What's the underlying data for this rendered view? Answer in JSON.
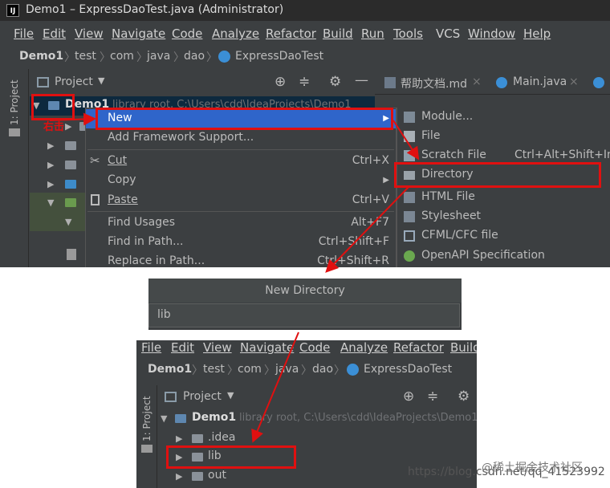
{
  "top": {
    "title": "Demo1 – ExpressDaoTest.java (Administrator)",
    "logo_text": "IJ",
    "menu": [
      "File",
      "Edit",
      "View",
      "Navigate",
      "Code",
      "Analyze",
      "Refactor",
      "Build",
      "Run",
      "Tools",
      "VCS",
      "Window",
      "Help"
    ],
    "breadcrumbs": [
      "Demo1",
      "test",
      "com",
      "java",
      "dao",
      "ExpressDaoTest"
    ],
    "project_label": "Project",
    "side_tab": "1: Project",
    "tree_root": "Demo1",
    "tree_root_hint": "library root, C:\\Users\\cdd\\IdeaProjects\\Demo1",
    "annotation": "右击",
    "tabs": [
      "帮助文档.md",
      "Main.java"
    ],
    "context_menu": [
      {
        "label": "New",
        "shortcut": ""
      },
      {
        "label": "Add Framework Support...",
        "shortcut": ""
      },
      {
        "label": "Cut",
        "shortcut": "Ctrl+X"
      },
      {
        "label": "Copy",
        "shortcut": ""
      },
      {
        "label": "Paste",
        "shortcut": "Ctrl+V"
      },
      {
        "label": "Find Usages",
        "shortcut": "Alt+F7"
      },
      {
        "label": "Find in Path...",
        "shortcut": "Ctrl+Shift+F"
      },
      {
        "label": "Replace in Path...",
        "shortcut": "Ctrl+Shift+R"
      }
    ],
    "submenu": [
      {
        "label": "Module...",
        "shortcut": ""
      },
      {
        "label": "File",
        "shortcut": ""
      },
      {
        "label": "Scratch File",
        "shortcut": "Ctrl+Alt+Shift+Ins"
      },
      {
        "label": "Directory",
        "shortcut": ""
      },
      {
        "label": "HTML File",
        "shortcut": ""
      },
      {
        "label": "Stylesheet",
        "shortcut": ""
      },
      {
        "label": "CFML/CFC file",
        "shortcut": ""
      },
      {
        "label": "OpenAPI Specification",
        "shortcut": ""
      }
    ]
  },
  "dialog": {
    "title": "New Directory",
    "value": "lib"
  },
  "bottom": {
    "menu": [
      "File",
      "Edit",
      "View",
      "Navigate",
      "Code",
      "Analyze",
      "Refactor",
      "Build"
    ],
    "breadcrumbs": [
      "Demo1",
      "test",
      "com",
      "java",
      "dao",
      "ExpressDaoTest"
    ],
    "project_label": "Project",
    "side_tab": "1: Project",
    "tree_root": "Demo1",
    "tree_root_hint": "library root, C:\\Users\\cdd\\IdeaProjects\\Demo1",
    "tree_items": [
      ".idea",
      "lib",
      "out"
    ]
  },
  "watermarks": {
    "csdn": "https://blog.csdn.net/qq_41523992",
    "juejin": "@稀土掘金技术社区"
  },
  "colors": {
    "ide_bg": "#3c3f41",
    "highlight": "#2f65ca",
    "annotation_red": "#e01010"
  }
}
